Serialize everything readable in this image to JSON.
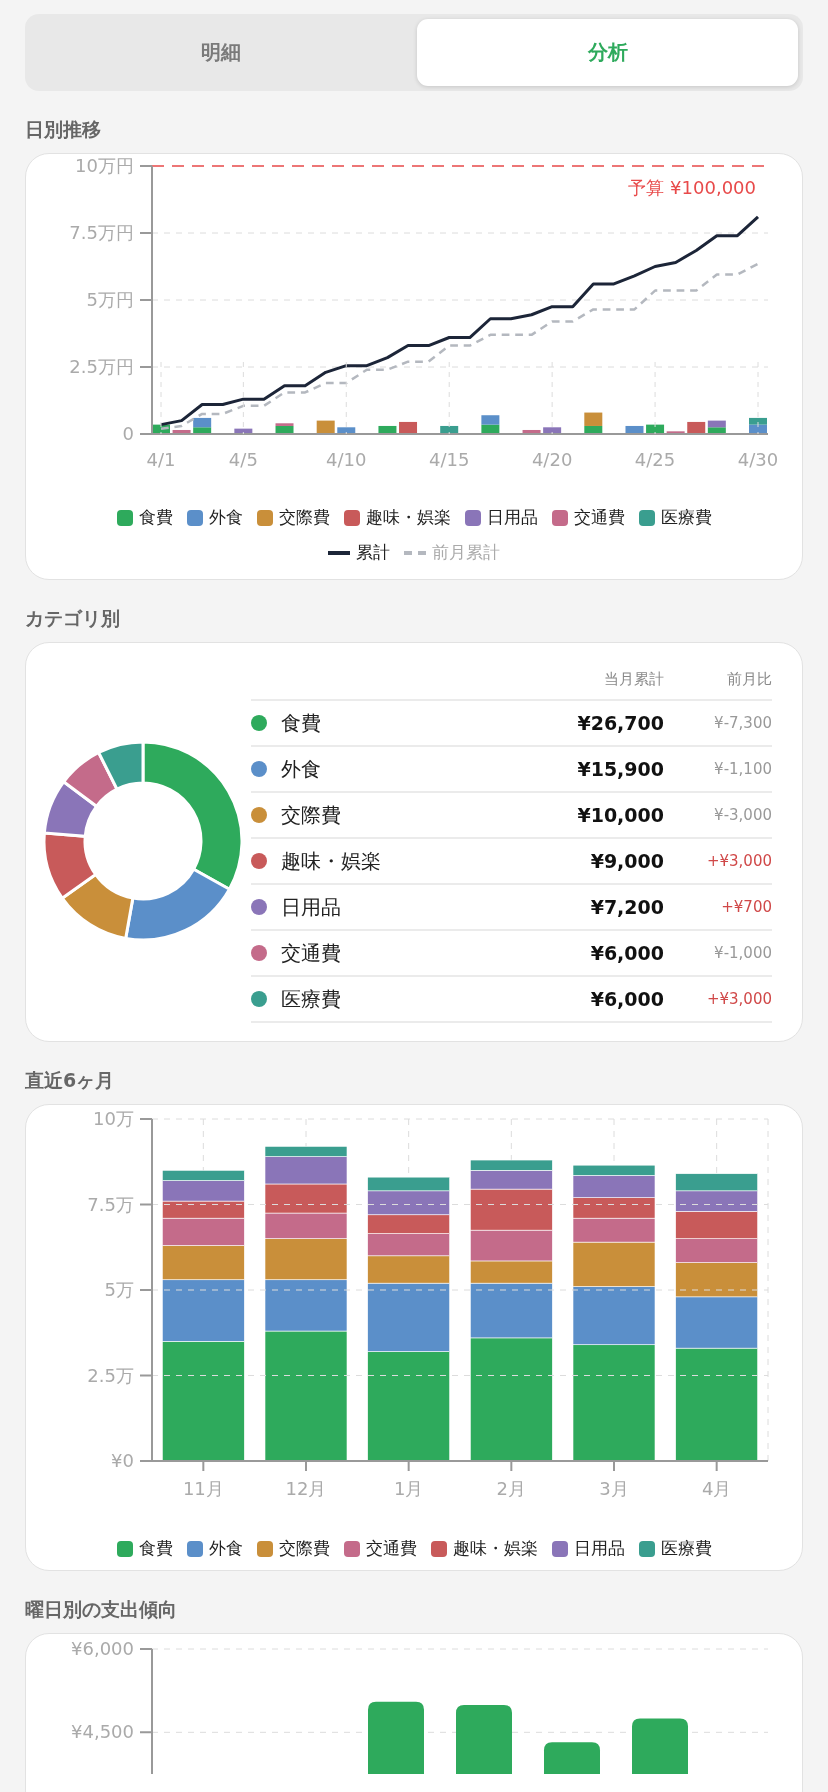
{
  "tabs": [
    {
      "label": "明細",
      "selected": false
    },
    {
      "label": "分析",
      "selected": true
    }
  ],
  "daily": {
    "heading": "日別推移",
    "chart_data": {
      "type": "bar",
      "stacked": true,
      "grid": true,
      "categories": [
        "4/1",
        null,
        null,
        null,
        "4/5",
        null,
        null,
        null,
        null,
        "4/10",
        null,
        null,
        null,
        null,
        "4/15",
        null,
        null,
        null,
        null,
        "4/20",
        null,
        null,
        null,
        null,
        "4/25",
        null,
        null,
        null,
        null,
        "4/30"
      ],
      "ylim": [
        0,
        10
      ],
      "yticks": [
        {
          "value": 0,
          "label": "0"
        },
        {
          "value": 2.5,
          "label": "2.5万円"
        },
        {
          "value": 5,
          "label": "5万円"
        },
        {
          "value": 7.5,
          "label": "7.5万円"
        },
        {
          "value": 10,
          "label": "10万円"
        }
      ],
      "series": [
        {
          "name": "食費",
          "color": "#2eaa5c",
          "values": [
            0.35,
            null,
            0.25,
            null,
            null,
            null,
            0.3,
            null,
            null,
            null,
            null,
            0.3,
            null,
            null,
            null,
            null,
            0.35,
            null,
            null,
            null,
            null,
            0.3,
            null,
            null,
            0.35,
            null,
            null,
            0.25,
            null,
            null
          ]
        },
        {
          "name": "外食",
          "color": "#5b8fc9",
          "values": [
            null,
            null,
            0.35,
            null,
            null,
            null,
            null,
            null,
            null,
            0.25,
            null,
            null,
            null,
            null,
            null,
            null,
            0.35,
            null,
            null,
            null,
            null,
            null,
            null,
            0.3,
            null,
            null,
            null,
            null,
            null,
            0.35
          ]
        },
        {
          "name": "交際費",
          "color": "#c98f3a",
          "values": [
            null,
            null,
            null,
            null,
            null,
            null,
            null,
            null,
            0.5,
            null,
            null,
            null,
            null,
            null,
            null,
            null,
            null,
            null,
            null,
            null,
            null,
            0.5,
            null,
            null,
            null,
            null,
            null,
            null,
            null,
            null
          ]
        },
        {
          "name": "趣味・娯楽",
          "color": "#c85a5a",
          "values": [
            null,
            null,
            null,
            null,
            null,
            null,
            null,
            null,
            null,
            null,
            null,
            null,
            0.45,
            null,
            null,
            null,
            null,
            null,
            null,
            null,
            null,
            null,
            null,
            null,
            null,
            null,
            0.45,
            null,
            null,
            null
          ]
        },
        {
          "name": "日用品",
          "color": "#8a75b8",
          "values": [
            null,
            null,
            null,
            null,
            0.2,
            null,
            null,
            null,
            null,
            null,
            null,
            null,
            null,
            null,
            null,
            null,
            null,
            null,
            null,
            0.25,
            null,
            null,
            null,
            null,
            null,
            null,
            null,
            0.25,
            null,
            null
          ]
        },
        {
          "name": "交通費",
          "color": "#c46b8a",
          "values": [
            null,
            0.15,
            null,
            null,
            null,
            null,
            0.1,
            null,
            null,
            null,
            null,
            null,
            null,
            null,
            null,
            null,
            null,
            null,
            0.15,
            null,
            null,
            null,
            null,
            null,
            null,
            0.1,
            null,
            null,
            null,
            null
          ]
        },
        {
          "name": "医療費",
          "color": "#3a9e8f",
          "values": [
            null,
            null,
            null,
            null,
            null,
            null,
            null,
            null,
            null,
            null,
            null,
            null,
            null,
            null,
            0.3,
            null,
            null,
            null,
            null,
            null,
            null,
            null,
            null,
            null,
            null,
            null,
            null,
            null,
            null,
            0.25
          ]
        },
        {
          "name": "累計",
          "color": "#1c2538",
          "type": "line",
          "line_style": "solid",
          "values": [
            0.35,
            0.5,
            1.1,
            1.1,
            1.3,
            1.3,
            1.8,
            1.8,
            2.3,
            2.55,
            2.55,
            2.85,
            3.3,
            3.3,
            3.6,
            3.6,
            4.3,
            4.3,
            4.45,
            4.75,
            4.75,
            5.6,
            5.6,
            5.9,
            6.25,
            6.4,
            6.85,
            7.4,
            7.4,
            8.1
          ]
        },
        {
          "name": "前月累計",
          "color": "#b4b8bf",
          "type": "line",
          "line_style": "dashed",
          "values": [
            0.2,
            0.3,
            0.75,
            0.75,
            1.05,
            1.05,
            1.55,
            1.55,
            1.9,
            1.9,
            2.4,
            2.4,
            2.7,
            2.7,
            3.3,
            3.3,
            3.7,
            3.7,
            3.7,
            4.2,
            4.2,
            4.65,
            4.65,
            4.65,
            5.35,
            5.35,
            5.35,
            5.95,
            5.95,
            6.35
          ]
        }
      ],
      "ref_lines": [
        {
          "axis": "y",
          "value": 10,
          "label": "予算 ¥100,000",
          "color": "#e84a4a"
        }
      ]
    }
  },
  "category": {
    "heading": "カテゴリ別",
    "chart_data": {
      "type": "donut",
      "values": [
        33.1,
        19.7,
        12.4,
        11.1,
        8.9,
        7.4,
        7.4
      ]
    },
    "table": {
      "columns": [
        "当月累計",
        "前月比"
      ],
      "rows": [
        {
          "name": "食費",
          "color": "#2eaa5c",
          "amount": "¥26,700",
          "change": "¥-7,300",
          "increase": false
        },
        {
          "name": "外食",
          "color": "#5b8fc9",
          "amount": "¥15,900",
          "change": "¥-1,100",
          "increase": false
        },
        {
          "name": "交際費",
          "color": "#c98f3a",
          "amount": "¥10,000",
          "change": "¥-3,000",
          "increase": false
        },
        {
          "name": "趣味・娯楽",
          "color": "#c85a5a",
          "amount": "¥9,000",
          "change": "+¥3,000",
          "increase": true
        },
        {
          "name": "日用品",
          "color": "#8a75b8",
          "amount": "¥7,200",
          "change": "+¥700",
          "increase": true
        },
        {
          "name": "交通費",
          "color": "#c46b8a",
          "amount": "¥6,000",
          "change": "¥-1,000",
          "increase": false
        },
        {
          "name": "医療費",
          "color": "#3a9e8f",
          "amount": "¥6,000",
          "change": "+¥3,000",
          "increase": true
        }
      ]
    }
  },
  "monthly": {
    "heading": "直近6ヶ月",
    "chart_data": {
      "type": "bar",
      "stacked": true,
      "grid": true,
      "categories": [
        "11月",
        "12月",
        "1月",
        "2月",
        "3月",
        "4月"
      ],
      "ylim": [
        0,
        10
      ],
      "yticks": [
        {
          "value": 0,
          "label": "¥0"
        },
        {
          "value": 2.5,
          "label": "2.5万"
        },
        {
          "value": 5,
          "label": "5万"
        },
        {
          "value": 7.5,
          "label": "7.5万"
        },
        {
          "value": 10,
          "label": "10万"
        }
      ],
      "series": [
        {
          "name": "食費",
          "color": "#2eaa5c",
          "values": [
            3.5,
            3.8,
            3.2,
            3.6,
            3.4,
            3.3
          ]
        },
        {
          "name": "外食",
          "color": "#5b8fc9",
          "values": [
            1.8,
            1.5,
            2.0,
            1.6,
            1.7,
            1.5
          ]
        },
        {
          "name": "交際費",
          "color": "#c98f3a",
          "values": [
            1.0,
            1.2,
            0.8,
            0.65,
            1.3,
            1.0
          ]
        },
        {
          "name": "交通費",
          "color": "#c46b8a",
          "values": [
            0.8,
            0.75,
            0.65,
            0.9,
            0.7,
            0.7
          ]
        },
        {
          "name": "趣味・娯楽",
          "color": "#c85a5a",
          "values": [
            0.5,
            0.85,
            0.55,
            1.2,
            0.6,
            0.8
          ]
        },
        {
          "name": "日用品",
          "color": "#8a75b8",
          "values": [
            0.6,
            0.8,
            0.7,
            0.55,
            0.65,
            0.6
          ]
        },
        {
          "name": "医療費",
          "color": "#3a9e8f",
          "values": [
            0.3,
            0.3,
            0.4,
            0.3,
            0.3,
            0.5
          ]
        }
      ]
    }
  },
  "weekday": {
    "heading": "曜日別の支出傾向",
    "chart_data": {
      "type": "bar",
      "ylim": [
        3750,
        6000
      ],
      "yticks": [
        {
          "value": 4500,
          "label": "¥4,500"
        },
        {
          "value": 6000,
          "label": "¥6,000"
        }
      ],
      "values": [
        null,
        null,
        5050,
        4990,
        4320,
        4750,
        null
      ]
    }
  }
}
